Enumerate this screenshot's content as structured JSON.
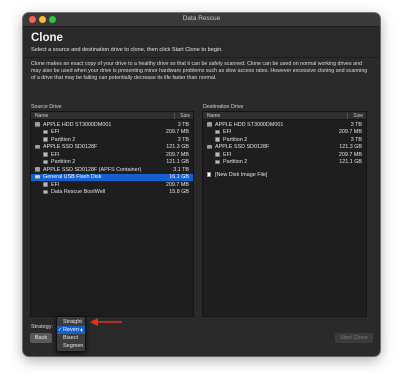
{
  "window": {
    "title": "Data Rescue"
  },
  "header": {
    "title": "Clone",
    "subtitle": "Select a source and destination drive to clone, then click Start Clone to begin."
  },
  "description": "Clone makes an exact copy of your drive to a healthy drive so that it can be safely scanned. Clone can be used on normal working drives and may also be used when your drive is presenting minor hardware problems such as slow access rates. However excessive cloning and scanning of a drive that may be failing can potentially decrease its life faster than normal.",
  "source": {
    "label": "Source Drive",
    "col_name": "Name",
    "col_size": "Size",
    "rows": [
      {
        "label": "APPLE HDD ST3000DM001",
        "size": "3 TB"
      },
      {
        "label": "EFI",
        "size": "209.7 MB"
      },
      {
        "label": "Partition 2",
        "size": "3 TB"
      },
      {
        "label": "APPLE SSD SD0128F",
        "size": "121.3 GB"
      },
      {
        "label": "EFI",
        "size": "209.7 MB"
      },
      {
        "label": "Partition 2",
        "size": "121.1 GB"
      },
      {
        "label": "APPLE SSD SD0128F (APFS Container)",
        "size": "3.1 TB"
      },
      {
        "label": "General USB Flash Disk",
        "size": "16.1 GB"
      },
      {
        "label": "EFI",
        "size": "209.7 MB"
      },
      {
        "label": "Data Rescue BootWell",
        "size": "15.8 GB"
      }
    ]
  },
  "destination": {
    "label": "Destination Drive",
    "col_name": "Name",
    "col_size": "Size",
    "rows": [
      {
        "label": "APPLE HDD ST3000DM001",
        "size": "3 TB"
      },
      {
        "label": "EFI",
        "size": "209.7 MB"
      },
      {
        "label": "Partition 2",
        "size": "3 TB"
      },
      {
        "label": "APPLE SSD SD0128F",
        "size": "121.3 GB"
      },
      {
        "label": "EFI",
        "size": "209.7 MB"
      },
      {
        "label": "Partition 2",
        "size": "121.1 GB"
      },
      {
        "label": "[New Disk Image File]",
        "size": ""
      }
    ]
  },
  "strategy": {
    "label": "Strategy:",
    "selected": "Reverse",
    "options": [
      "Straight",
      "Reverse",
      "Bisect",
      "Segmen"
    ],
    "check": "✓"
  },
  "buttons": {
    "back": "Back",
    "start": "Start Clone"
  },
  "colors": {
    "selection": "#1560d0",
    "annotation_arrow": "#e0321e",
    "window_bg": "#2a2a2a",
    "list_bg": "#1e1e1e"
  }
}
